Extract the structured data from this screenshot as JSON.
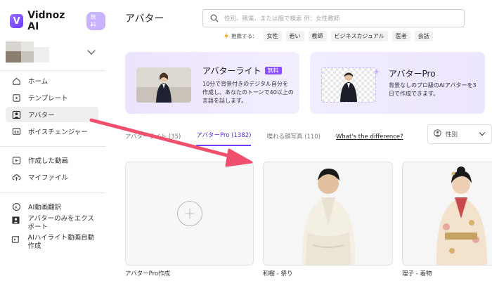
{
  "brand": {
    "name": "Vidnoz AI",
    "badge": "無料"
  },
  "sidebar": {
    "items": [
      {
        "label": "ホーム",
        "icon": "home-icon"
      },
      {
        "label": "テンプレート",
        "icon": "template-icon"
      },
      {
        "label": "アバター",
        "icon": "avatar-icon",
        "active": true
      },
      {
        "label": "ボイスチェンジャー",
        "icon": "voice-changer-icon"
      },
      {
        "label": "作成した動画",
        "icon": "video-icon"
      },
      {
        "label": "マイファイル",
        "icon": "cloud-upload-icon"
      },
      {
        "label": "AI動画翻訳",
        "icon": "translate-icon"
      },
      {
        "label": "アバターのみをエクスポート",
        "icon": "export-icon"
      },
      {
        "label": "AIハイライト動画自動作成",
        "icon": "highlight-icon"
      }
    ]
  },
  "header": {
    "title": "アバター",
    "search_placeholder": "性別、職業、または服で検索 例：女性教師",
    "tags_label": "推薦する：",
    "tags": [
      "女性",
      "若い",
      "教師",
      "ビジネスカジュアル",
      "医者",
      "会話"
    ]
  },
  "banners": {
    "lite": {
      "title": "アバターライト",
      "badge": "無料",
      "desc": "10分で背景付きのデジタル自分を作成し、あなたのトーンで40以上の言語を話します。"
    },
    "pro": {
      "title": "アバターPro",
      "desc": "背景なしのプロ級のAIアバターを3日で作成できます。"
    }
  },
  "tabs": [
    {
      "label": "アバターライト (35)"
    },
    {
      "label": "アバターPro (1382)",
      "active": true
    },
    {
      "label": "喋れる顔写真 (110)"
    },
    {
      "label": "What's the difference?",
      "link": true
    }
  ],
  "filter": {
    "gender_label": "性別"
  },
  "cards": [
    {
      "label": "アバターPro作成"
    },
    {
      "label": "和樹 - 祭り"
    },
    {
      "label": "理子 - 着物"
    }
  ],
  "colors": {
    "accent": "#6a3dff",
    "arrow": "#f0506e"
  }
}
